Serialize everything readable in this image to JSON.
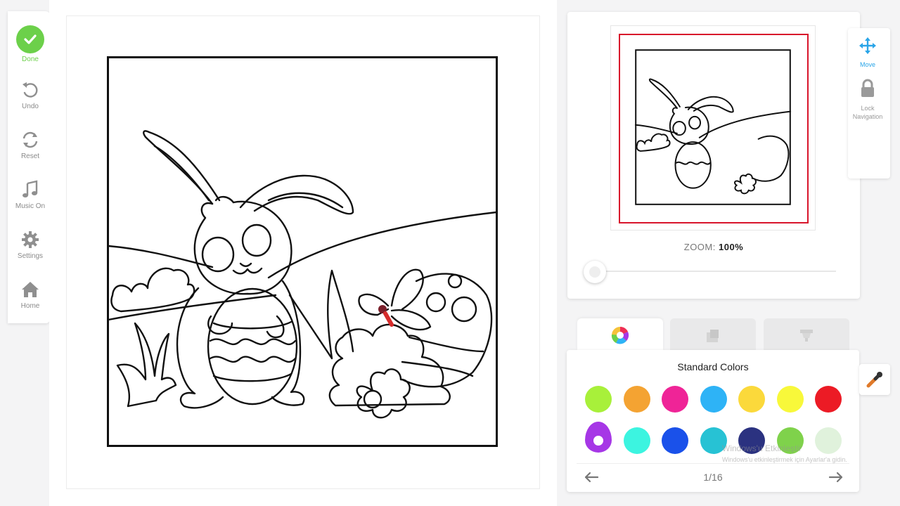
{
  "toolbar": {
    "done": "Done",
    "undo": "Undo",
    "reset": "Reset",
    "music": "Music On",
    "settings": "Settings",
    "home": "Home"
  },
  "preview": {
    "zoom_label": "ZOOM:",
    "zoom_value": "100%",
    "zoom_level": 0.0
  },
  "side_tools": {
    "move": "Move",
    "lock_line1": "Lock",
    "lock_line2": "Navigation"
  },
  "palette": {
    "title": "Standard Colors",
    "page": "1/16",
    "colors_row1": [
      "#a8f03a",
      "#f4a332",
      "#ef2497",
      "#2eb3f6",
      "#fbd93b",
      "#f8f83a",
      "#ec1b25"
    ],
    "colors_row2": [
      "#a637e6",
      "#3cf4e0",
      "#1a51ea",
      "#27c2d4",
      "#2b3280",
      "#7fd24b",
      "#e0f2dc"
    ],
    "selected_index_row2": 0
  },
  "watermark": {
    "line1": "Windows'u Etkinleştir",
    "line2": "Windows'u etkinleştirmek için Ayarlar'a gidin."
  },
  "colors": {
    "accent_green": "#6cd04a",
    "accent_blue": "#2aa5e8",
    "frame_red": "#d8142b"
  },
  "icons": {
    "done": "check-icon",
    "undo": "undo-icon",
    "reset": "reset-icon",
    "music": "music-note-icon",
    "settings": "gear-icon",
    "home": "home-icon",
    "move": "move-arrows-icon",
    "lock": "lock-icon",
    "dropper": "eyedropper-icon"
  }
}
